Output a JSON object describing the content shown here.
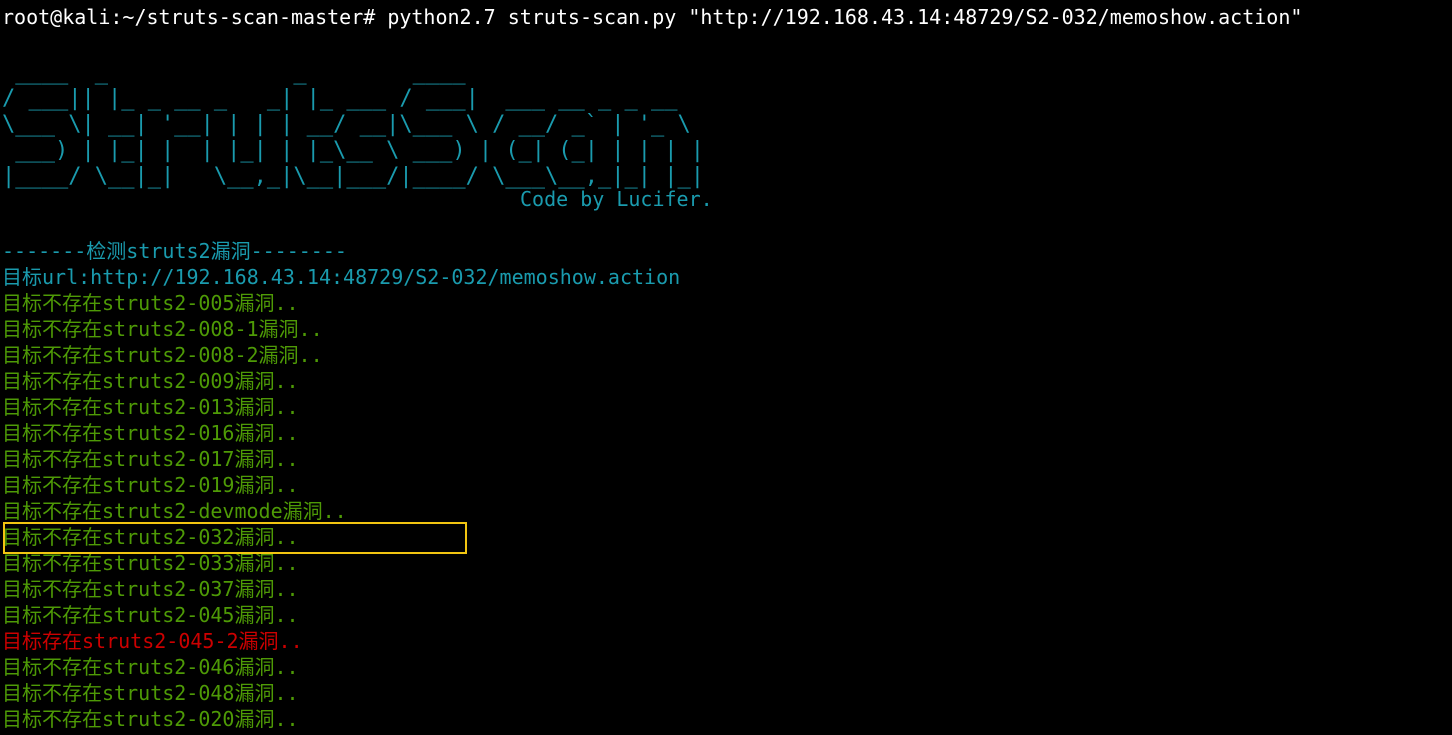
{
  "terminal": {
    "command_line": "root@kali:~/struts-scan-master# python2.7 struts-scan.py \"http://192.168.43.14:48729/S2-032/memoshow.action\"",
    "banner": [
      " ____  _              _        ____",
      "/ ___|| |_ _ __ _   _| |_ ___ / ___|  ___ __ _ _ __",
      "\\___ \\| __| '__| | | | __/ __|\\___ \\ / __/ _` | '_ \\",
      " ___) | |_| |  | |_| | |_\\__ \\ ___) | (_| (_| | | | |",
      "|____/ \\__|_|   \\__,_|\\__|___/|____/ \\___\\__,_|_| |_|"
    ],
    "credit": "Code by Lucifer.",
    "section_header": "-------检测struts2漏洞--------",
    "target_url": "目标url:http://192.168.43.14:48729/S2-032/memoshow.action",
    "results": [
      {
        "text": "目标不存在struts2-005漏洞..",
        "status": "absent"
      },
      {
        "text": "目标不存在struts2-008-1漏洞..",
        "status": "absent"
      },
      {
        "text": "目标不存在struts2-008-2漏洞..",
        "status": "absent"
      },
      {
        "text": "目标不存在struts2-009漏洞..",
        "status": "absent"
      },
      {
        "text": "目标不存在struts2-013漏洞..",
        "status": "absent"
      },
      {
        "text": "目标不存在struts2-016漏洞..",
        "status": "absent"
      },
      {
        "text": "目标不存在struts2-017漏洞..",
        "status": "absent"
      },
      {
        "text": "目标不存在struts2-019漏洞..",
        "status": "absent"
      },
      {
        "text": "目标不存在struts2-devmode漏洞..",
        "status": "absent"
      },
      {
        "text": "目标不存在struts2-032漏洞..",
        "status": "absent"
      },
      {
        "text": "目标不存在struts2-033漏洞..",
        "status": "absent"
      },
      {
        "text": "目标不存在struts2-037漏洞..",
        "status": "absent"
      },
      {
        "text": "目标不存在struts2-045漏洞..",
        "status": "absent"
      },
      {
        "text": "目标存在struts2-045-2漏洞..",
        "status": "present"
      },
      {
        "text": "目标不存在struts2-046漏洞..",
        "status": "absent"
      },
      {
        "text": "目标不存在struts2-048漏洞..",
        "status": "absent"
      },
      {
        "text": "目标不存在struts2-020漏洞..",
        "status": "absent"
      }
    ],
    "colors": {
      "background": "#000000",
      "prompt": "#ffffff",
      "banner": "#1a9bae",
      "absent": "#4e9a06",
      "present": "#cc0000",
      "highlight": "#f2c511"
    }
  }
}
